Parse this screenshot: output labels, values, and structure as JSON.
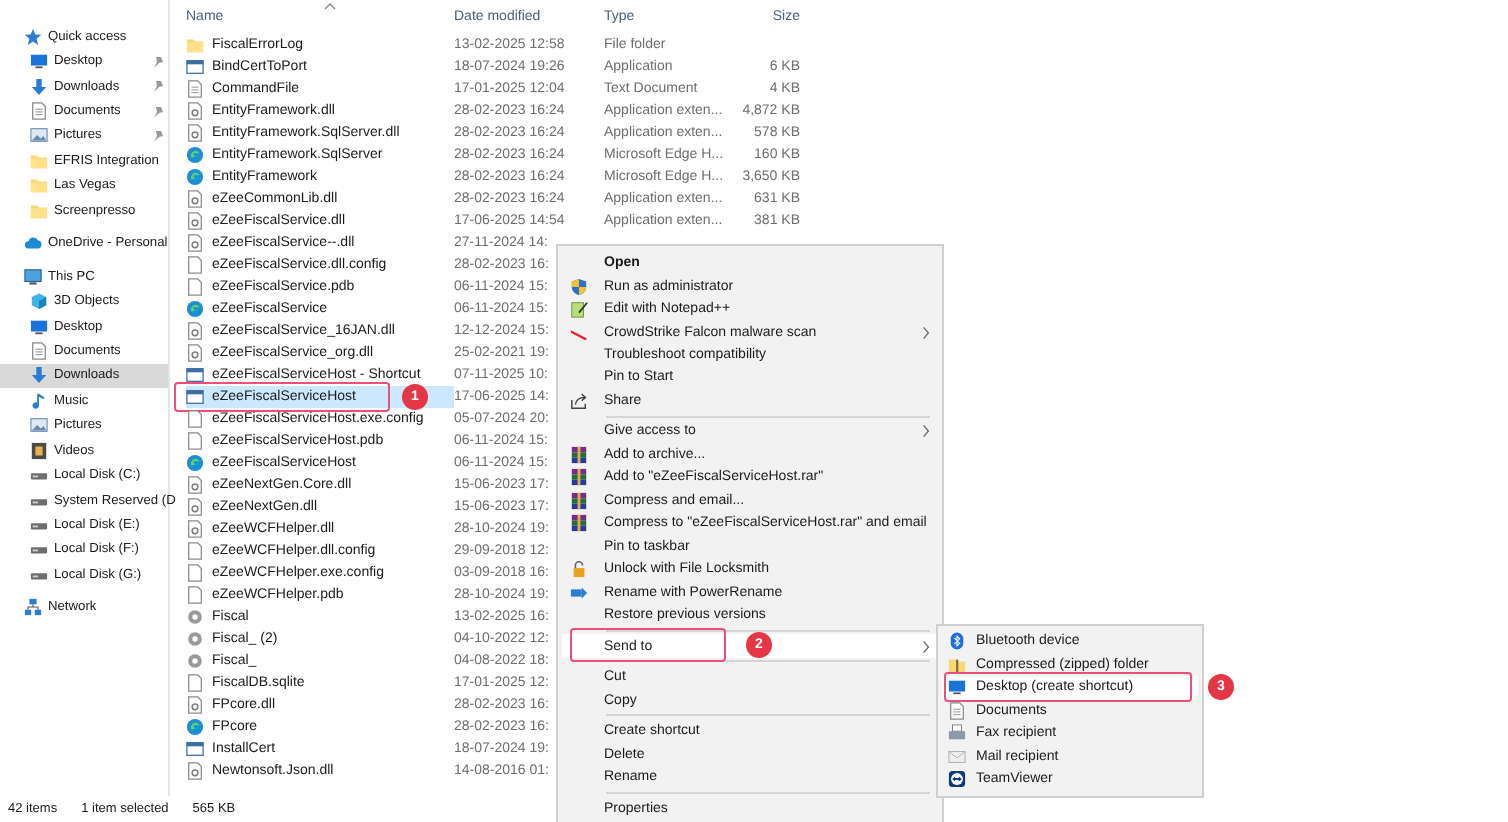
{
  "sidebar": {
    "groups": [
      {
        "label": "Quick access",
        "kind": "star",
        "children": [
          {
            "label": "Desktop",
            "kind": "desktop",
            "pinned": true,
            "selected": false
          },
          {
            "label": "Downloads",
            "kind": "download",
            "pinned": true,
            "selected": false
          },
          {
            "label": "Documents",
            "kind": "documents",
            "pinned": true,
            "selected": false
          },
          {
            "label": "Pictures",
            "kind": "pictures",
            "pinned": true,
            "selected": false
          },
          {
            "label": "EFRIS Integration",
            "kind": "folder",
            "pinned": false,
            "selected": false
          },
          {
            "label": "Las Vegas",
            "kind": "folder",
            "pinned": false,
            "selected": false
          },
          {
            "label": "Screenpresso",
            "kind": "folder",
            "pinned": false,
            "selected": false
          }
        ]
      },
      {
        "label": "OneDrive - Personal",
        "kind": "cloud"
      },
      {
        "label": "This PC",
        "kind": "pc",
        "children": [
          {
            "label": "3D Objects",
            "kind": "cube",
            "pinned": false,
            "selected": false
          },
          {
            "label": "Desktop",
            "kind": "desktop",
            "pinned": false,
            "selected": false
          },
          {
            "label": "Documents",
            "kind": "documents",
            "pinned": false,
            "selected": false
          },
          {
            "label": "Downloads",
            "kind": "download",
            "pinned": false,
            "selected": true
          },
          {
            "label": "Music",
            "kind": "music",
            "pinned": false,
            "selected": false
          },
          {
            "label": "Pictures",
            "kind": "pictures",
            "pinned": false,
            "selected": false
          },
          {
            "label": "Videos",
            "kind": "video",
            "pinned": false,
            "selected": false
          },
          {
            "label": "Local Disk (C:)",
            "kind": "drive",
            "pinned": false,
            "selected": false
          },
          {
            "label": "System Reserved (D",
            "kind": "drive",
            "pinned": false,
            "selected": false
          },
          {
            "label": "Local Disk (E:)",
            "kind": "drive",
            "pinned": false,
            "selected": false
          },
          {
            "label": "Local Disk (F:)",
            "kind": "drive",
            "pinned": false,
            "selected": false
          },
          {
            "label": "Local Disk (G:)",
            "kind": "drive",
            "pinned": false,
            "selected": false
          }
        ]
      },
      {
        "label": "Network",
        "kind": "network"
      }
    ]
  },
  "file_list": {
    "columns": [
      "Name",
      "Date modified",
      "Type",
      "Size"
    ],
    "rows": [
      {
        "name": "FiscalErrorLog",
        "kind": "folder",
        "date": "13-02-2025 12:58",
        "type": "File folder",
        "selected": false
      },
      {
        "name": "BindCertToPort",
        "kind": "app",
        "date": "18-07-2024 19:26",
        "type": "Application",
        "size": "6 KB",
        "selected": false
      },
      {
        "name": "CommandFile",
        "kind": "text",
        "date": "17-01-2025 12:04",
        "type": "Text Document",
        "size": "4 KB",
        "selected": false
      },
      {
        "name": "EntityFramework.dll",
        "kind": "dll",
        "date": "28-02-2023 16:24",
        "type": "Application exten...",
        "size": "4,872 KB",
        "selected": false
      },
      {
        "name": "EntityFramework.SqlServer.dll",
        "kind": "dll",
        "date": "28-02-2023 16:24",
        "type": "Application exten...",
        "size": "578 KB",
        "selected": false
      },
      {
        "name": "EntityFramework.SqlServer",
        "kind": "edge",
        "date": "28-02-2023 16:24",
        "type": "Microsoft Edge H...",
        "size": "160 KB",
        "selected": false
      },
      {
        "name": "EntityFramework",
        "kind": "edge",
        "date": "28-02-2023 16:24",
        "type": "Microsoft Edge H...",
        "size": "3,650 KB",
        "selected": false
      },
      {
        "name": "eZeeCommonLib.dll",
        "kind": "dll",
        "date": "28-02-2023 16:24",
        "type": "Application exten...",
        "size": "631 KB",
        "selected": false
      },
      {
        "name": "eZeeFiscalService.dll",
        "kind": "dll",
        "date": "17-06-2025 14:54",
        "type": "Application exten...",
        "size": "381 KB",
        "selected": false
      },
      {
        "name": "eZeeFiscalService--.dll",
        "kind": "dll",
        "date": "27-11-2024 14:",
        "selected": false
      },
      {
        "name": "eZeeFiscalService.dll.config",
        "kind": "blank",
        "date": "28-02-2023 16:",
        "selected": false
      },
      {
        "name": "eZeeFiscalService.pdb",
        "kind": "blank",
        "date": "06-11-2024 15:",
        "selected": false
      },
      {
        "name": "eZeeFiscalService",
        "kind": "edge",
        "date": "06-11-2024 15:",
        "selected": false
      },
      {
        "name": "eZeeFiscalService_16JAN.dll",
        "kind": "dll",
        "date": "12-12-2024 15:",
        "selected": false
      },
      {
        "name": "eZeeFiscalService_org.dll",
        "kind": "dll",
        "date": "25-02-2021 19:",
        "selected": false
      },
      {
        "name": "eZeeFiscalServiceHost - Shortcut",
        "kind": "app",
        "date": "07-11-2025 10:",
        "selected": false
      },
      {
        "name": "eZeeFiscalServiceHost",
        "kind": "app",
        "date": "17-06-2025 14:",
        "selected": true,
        "callout": "1"
      },
      {
        "name": "eZeeFiscalServiceHost.exe.config",
        "kind": "blank",
        "date": "05-07-2024 20:",
        "selected": false
      },
      {
        "name": "eZeeFiscalServiceHost.pdb",
        "kind": "blank",
        "date": "06-11-2024 15:",
        "selected": false
      },
      {
        "name": "eZeeFiscalServiceHost",
        "kind": "edge",
        "date": "06-11-2024 15:",
        "selected": false
      },
      {
        "name": "eZeeNextGen.Core.dll",
        "kind": "dll",
        "date": "15-06-2023 17:",
        "selected": false
      },
      {
        "name": "eZeeNextGen.dll",
        "kind": "dll",
        "date": "15-06-2023 17:",
        "selected": false
      },
      {
        "name": "eZeeWCFHelper.dll",
        "kind": "dll",
        "date": "28-10-2024 19:",
        "selected": false
      },
      {
        "name": "eZeeWCFHelper.dll.config",
        "kind": "blank",
        "date": "29-09-2018 12:",
        "selected": false
      },
      {
        "name": "eZeeWCFHelper.exe.config",
        "kind": "blank",
        "date": "03-09-2018 16:",
        "selected": false
      },
      {
        "name": "eZeeWCFHelper.pdb",
        "kind": "blank",
        "date": "28-10-2024 19:",
        "selected": false
      },
      {
        "name": "Fiscal",
        "kind": "gear",
        "date": "13-02-2025 16:",
        "selected": false
      },
      {
        "name": "Fiscal_ (2)",
        "kind": "gear",
        "date": "04-10-2022 12:",
        "selected": false
      },
      {
        "name": "Fiscal_",
        "kind": "gear",
        "date": "04-08-2022 18:",
        "selected": false
      },
      {
        "name": "FiscalDB.sqlite",
        "kind": "blank",
        "date": "17-01-2025 12:",
        "selected": false
      },
      {
        "name": "FPcore.dll",
        "kind": "dll",
        "date": "28-02-2023 16:",
        "selected": false
      },
      {
        "name": "FPcore",
        "kind": "edge",
        "date": "28-02-2023 16:",
        "selected": false
      },
      {
        "name": "InstallCert",
        "kind": "app",
        "date": "18-07-2024 19:",
        "selected": false
      },
      {
        "name": "Newtonsoft.Json.dll",
        "kind": "dll",
        "date": "14-08-2016 01:",
        "selected": false
      }
    ]
  },
  "context_menu": {
    "items": [
      {
        "kind": "plain",
        "label": "Open",
        "default": true,
        "submenu": false,
        "selected": false
      },
      {
        "kind": "shield",
        "label": "Run as administrator",
        "default": false,
        "submenu": false,
        "selected": false
      },
      {
        "kind": "notepad",
        "label": "Edit with Notepad++",
        "default": false,
        "submenu": false,
        "selected": false
      },
      {
        "kind": "slash",
        "label": "CrowdStrike Falcon malware scan",
        "default": false,
        "submenu": true,
        "selected": false
      },
      {
        "kind": "plain",
        "label": "Troubleshoot compatibility",
        "default": false,
        "submenu": false,
        "selected": false
      },
      {
        "kind": "plain",
        "label": "Pin to Start",
        "default": false,
        "submenu": false,
        "selected": false
      },
      {
        "kind": "share",
        "label": "Share",
        "default": false,
        "submenu": false,
        "selected": false
      },
      {
        "kind": "separator"
      },
      {
        "kind": "plain",
        "label": "Give access to",
        "default": false,
        "submenu": true,
        "selected": false
      },
      {
        "kind": "rar",
        "label": "Add to archive...",
        "default": false,
        "submenu": false,
        "selected": false
      },
      {
        "kind": "rar",
        "label": "Add to \"eZeeFiscalServiceHost.rar\"",
        "default": false,
        "submenu": false,
        "selected": false
      },
      {
        "kind": "rar",
        "label": "Compress and email...",
        "default": false,
        "submenu": false,
        "selected": false
      },
      {
        "kind": "rar",
        "label": "Compress to \"eZeeFiscalServiceHost.rar\" and email",
        "default": false,
        "submenu": false,
        "selected": false
      },
      {
        "kind": "plain",
        "label": "Pin to taskbar",
        "default": false,
        "submenu": false,
        "selected": false
      },
      {
        "kind": "lock",
        "label": "Unlock with File Locksmith",
        "default": false,
        "submenu": false,
        "selected": false
      },
      {
        "kind": "rename",
        "label": "Rename with PowerRename",
        "default": false,
        "submenu": false,
        "selected": false
      },
      {
        "kind": "plain",
        "label": "Restore previous versions",
        "default": false,
        "submenu": false,
        "selected": false
      },
      {
        "kind": "separator"
      },
      {
        "kind": "plain",
        "label": "Send to",
        "default": false,
        "submenu": true,
        "selected": true,
        "callout": "2"
      },
      {
        "kind": "separator"
      },
      {
        "kind": "plain",
        "label": "Cut",
        "default": false,
        "submenu": false,
        "selected": false
      },
      {
        "kind": "plain",
        "label": "Copy",
        "default": false,
        "submenu": false,
        "selected": false
      },
      {
        "kind": "separator"
      },
      {
        "kind": "plain",
        "label": "Create shortcut",
        "default": false,
        "submenu": false,
        "selected": false
      },
      {
        "kind": "plain",
        "label": "Delete",
        "default": false,
        "submenu": false,
        "selected": false
      },
      {
        "kind": "plain",
        "label": "Rename",
        "default": false,
        "submenu": false,
        "selected": false
      },
      {
        "kind": "separator"
      },
      {
        "kind": "plain",
        "label": "Properties",
        "default": false,
        "submenu": false,
        "selected": false
      }
    ]
  },
  "send_to_menu": {
    "items": [
      {
        "label": "Bluetooth device",
        "kind": "bluetooth",
        "selected": false
      },
      {
        "label": "Compressed (zipped) folder",
        "kind": "zip",
        "selected": false
      },
      {
        "label": "Desktop (create shortcut)",
        "kind": "desktop",
        "selected": true,
        "callout": "3"
      },
      {
        "label": "Documents",
        "kind": "documents",
        "selected": false
      },
      {
        "label": "Fax recipient",
        "kind": "fax",
        "selected": false
      },
      {
        "label": "Mail recipient",
        "kind": "mail",
        "selected": false
      },
      {
        "label": "TeamViewer",
        "kind": "teamviewer",
        "selected": false
      }
    ]
  },
  "status_bar": {
    "item_count": "42 items",
    "selection": "1 item selected",
    "selection_size": "565 KB"
  }
}
